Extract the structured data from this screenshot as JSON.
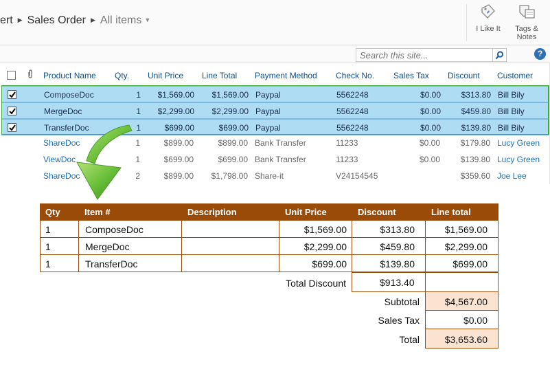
{
  "breadcrumb": {
    "partial": "ert",
    "list": "Sales Order",
    "view": "All items"
  },
  "ribbon": {
    "like_label": "I Like It",
    "tags_label_1": "Tags &",
    "tags_label_2": "Notes"
  },
  "search": {
    "placeholder": "Search this site..."
  },
  "help": {
    "label": "?"
  },
  "list": {
    "headers": [
      "Product Name",
      "Qty.",
      "Unit Price",
      "Line Total",
      "Payment Method",
      "Check No.",
      "Sales Tax",
      "Discount",
      "Customer"
    ],
    "rows": [
      {
        "product": "ComposeDoc",
        "qty": "1",
        "unit": "$1,569.00",
        "total": "$1,569.00",
        "payment": "Paypal",
        "check": "5562248",
        "tax": "$0.00",
        "discount": "$313.80",
        "customer": "Bill Bily",
        "selected": true
      },
      {
        "product": "MergeDoc",
        "qty": "1",
        "unit": "$2,299.00",
        "total": "$2,299.00",
        "payment": "Paypal",
        "check": "5562248",
        "tax": "$0.00",
        "discount": "$459.80",
        "customer": "Bill Bily",
        "selected": true
      },
      {
        "product": "TransferDoc",
        "qty": "1",
        "unit": "$699.00",
        "total": "$699.00",
        "payment": "Paypal",
        "check": "5562248",
        "tax": "$0.00",
        "discount": "$139.80",
        "customer": "Bill Bily",
        "selected": true
      },
      {
        "product": "ShareDoc",
        "qty": "1",
        "unit": "$899.00",
        "total": "$899.00",
        "payment": "Bank Transfer",
        "check": "11233",
        "tax": "$0.00",
        "discount": "$179.80",
        "customer": "Lucy Green",
        "selected": false
      },
      {
        "product": "ViewDoc",
        "qty": "1",
        "unit": "$699.00",
        "total": "$699.00",
        "payment": "Bank Transfer",
        "check": "11233",
        "tax": "$0.00",
        "discount": "$139.80",
        "customer": "Lucy Green",
        "selected": false
      },
      {
        "product": "ShareDoc",
        "qty": "2",
        "unit": "$899.00",
        "total": "$1,798.00",
        "payment": "Share-it",
        "check": "V24154545",
        "tax": "",
        "discount": "$359.60",
        "customer": "Joe Lee",
        "selected": false
      }
    ]
  },
  "invoice": {
    "headers": [
      "Qty",
      "Item #",
      "Description",
      "Unit Price",
      "Discount",
      "Line total"
    ],
    "rows": [
      {
        "qty": "1",
        "item": "ComposeDoc",
        "desc": "",
        "unit": "$1,569.00",
        "discount": "$313.80",
        "line": "$1,569.00"
      },
      {
        "qty": "1",
        "item": "MergeDoc",
        "desc": "",
        "unit": "$2,299.00",
        "discount": "$459.80",
        "line": "$2,299.00"
      },
      {
        "qty": "1",
        "item": "TransferDoc",
        "desc": "",
        "unit": "$699.00",
        "discount": "$139.80",
        "line": "$699.00"
      }
    ],
    "total_discount_label": "Total Discount",
    "total_discount": "$913.40",
    "subtotal_label": "Subtotal",
    "subtotal": "$4,567.00",
    "sales_tax_label": "Sales Tax",
    "sales_tax": "$0.00",
    "total_label": "Total",
    "total": "$3,653.60"
  },
  "colors": {
    "selection": "#aedcf3",
    "invoice_header": "#9a4b07",
    "highlight": "#fbe3d2",
    "arrow": "#4faa2a"
  }
}
